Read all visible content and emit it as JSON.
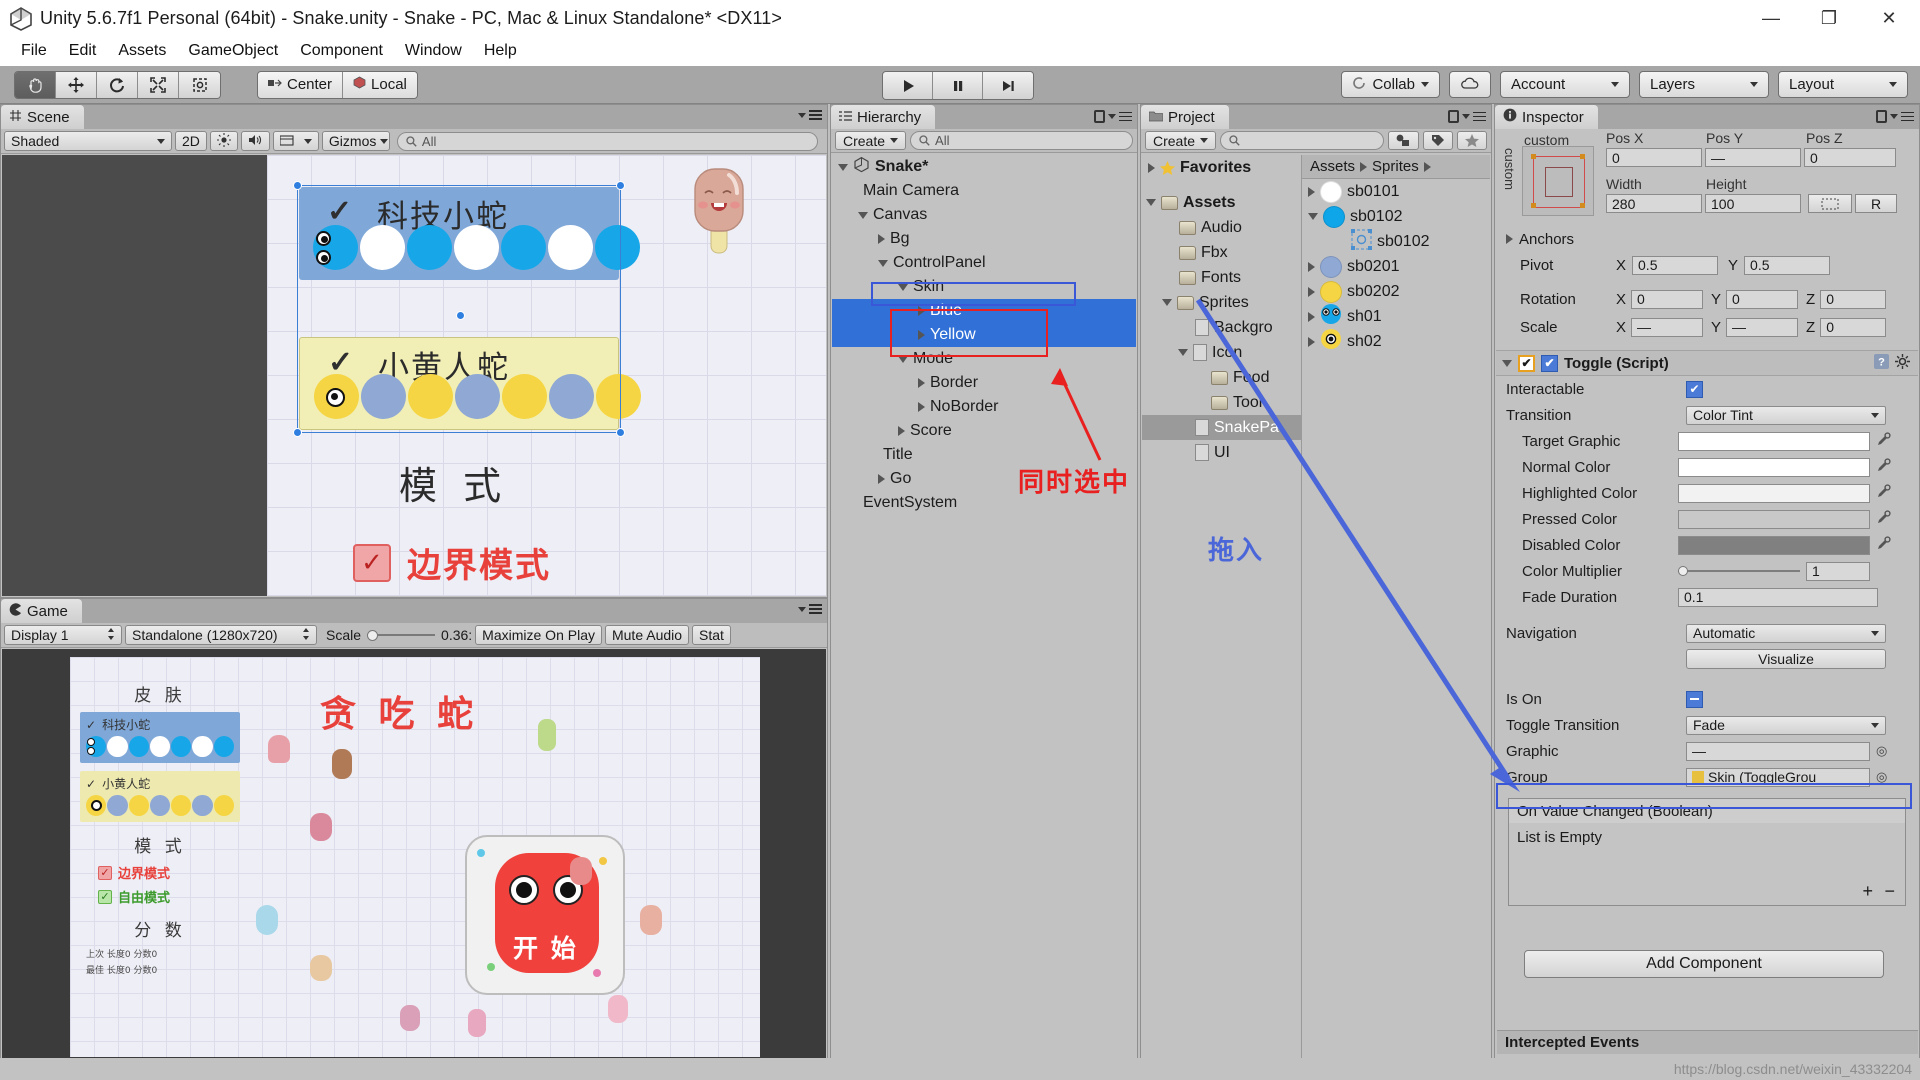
{
  "window": {
    "title": "Unity 5.6.7f1 Personal (64bit) - Snake.unity - Snake - PC, Mac & Linux Standalone* <DX11>",
    "minimize": "—",
    "maximize": "❐",
    "close": "✕"
  },
  "menubar": {
    "items": [
      "File",
      "Edit",
      "Assets",
      "GameObject",
      "Component",
      "Window",
      "Help"
    ]
  },
  "toolbar": {
    "tools": [
      "hand-tool",
      "move-tool",
      "rotate-tool",
      "scale-tool",
      "rect-tool"
    ],
    "pivot_mode": "Center",
    "handle_space": "Local",
    "play": "▶",
    "pause": "❚❚",
    "step": "▶❙",
    "collab": "Collab",
    "cloud": "cloud-icon",
    "account": "Account",
    "layers": "Layers",
    "layout": "Layout"
  },
  "scene": {
    "tab": "Scene",
    "shading": "Shaded",
    "mode_2d": "2D",
    "gizmos": "Gizmos",
    "search_placeholder": "All",
    "canvas": {
      "skin_blue": {
        "label": "科技小蛇",
        "check": "✓"
      },
      "skin_yellow": {
        "label": "小黄人蛇",
        "check": "✓"
      },
      "mode_title": "模 式",
      "mode_border": "边界模式"
    }
  },
  "game": {
    "tab": "Game",
    "display": "Display 1",
    "resolution": "Standalone (1280x720)",
    "scale_label": "Scale",
    "scale_value": "0.36:",
    "maximize": "Maximize On Play",
    "mute": "Mute Audio",
    "stats": "Stat",
    "screen": {
      "title": "贪 吃 蛇",
      "skin_heading": "皮 肤",
      "skin_blue": "科技小蛇",
      "skin_yellow": "小黄人蛇",
      "mode_heading": "模 式",
      "mode_border": "边界模式",
      "mode_free": "自由模式",
      "score_heading": "分 数",
      "score_line1": "上次  长度0  分数0",
      "score_line2": "最佳  长度0  分数0",
      "start_button": "开 始"
    }
  },
  "hierarchy": {
    "tab": "Hierarchy",
    "create": "Create",
    "search_placeholder": "All",
    "items": [
      {
        "label": "Snake*",
        "depth": 0,
        "arrow": "down",
        "icon": "unity-icon",
        "bold": true,
        "selected": false
      },
      {
        "label": "Main Camera",
        "depth": 1,
        "arrow": "none",
        "icon": "",
        "bold": false,
        "selected": false
      },
      {
        "label": "Canvas",
        "depth": 1,
        "arrow": "down",
        "icon": "",
        "bold": false,
        "selected": false
      },
      {
        "label": "Bg",
        "depth": 2,
        "arrow": "right",
        "icon": "",
        "bold": false,
        "selected": false
      },
      {
        "label": "ControlPanel",
        "depth": 2,
        "arrow": "down",
        "icon": "",
        "bold": false,
        "selected": false
      },
      {
        "label": "Skin",
        "depth": 3,
        "arrow": "down",
        "icon": "",
        "bold": false,
        "selected": false
      },
      {
        "label": "Blue",
        "depth": 4,
        "arrow": "right",
        "icon": "",
        "bold": false,
        "selected": true
      },
      {
        "label": "Yellow",
        "depth": 4,
        "arrow": "right",
        "icon": "",
        "bold": false,
        "selected": true
      },
      {
        "label": "Mode",
        "depth": 3,
        "arrow": "down",
        "icon": "",
        "bold": false,
        "selected": false
      },
      {
        "label": "Border",
        "depth": 4,
        "arrow": "right",
        "icon": "",
        "bold": false,
        "selected": false
      },
      {
        "label": "NoBorder",
        "depth": 4,
        "arrow": "right",
        "icon": "",
        "bold": false,
        "selected": false
      },
      {
        "label": "Score",
        "depth": 3,
        "arrow": "right",
        "icon": "",
        "bold": false,
        "selected": false
      },
      {
        "label": "Title",
        "depth": 2,
        "arrow": "none",
        "icon": "",
        "bold": false,
        "selected": false
      },
      {
        "label": "Go",
        "depth": 2,
        "arrow": "right",
        "icon": "",
        "bold": false,
        "selected": false
      },
      {
        "label": "EventSystem",
        "depth": 1,
        "arrow": "none",
        "icon": "",
        "bold": false,
        "selected": false
      }
    ]
  },
  "project": {
    "tab": "Project",
    "create": "Create",
    "search_placeholder": "",
    "favorites": "Favorites",
    "breadcrumb": [
      "Assets",
      "Sprites"
    ],
    "tree": [
      {
        "label": "Assets",
        "depth": 0,
        "arrow": "down",
        "icon": "folder",
        "selected": false
      },
      {
        "label": "Audio",
        "depth": 1,
        "arrow": "none",
        "icon": "folder",
        "selected": false
      },
      {
        "label": "Fbx",
        "depth": 1,
        "arrow": "none",
        "icon": "folder",
        "selected": false
      },
      {
        "label": "Fonts",
        "depth": 1,
        "arrow": "none",
        "icon": "folder",
        "selected": false
      },
      {
        "label": "Sprites",
        "depth": 1,
        "arrow": "down",
        "icon": "folder",
        "selected": false
      },
      {
        "label": "Backgro",
        "depth": 2,
        "arrow": "none",
        "icon": "sprite",
        "selected": false
      },
      {
        "label": "Icon",
        "depth": 2,
        "arrow": "down",
        "icon": "sprite",
        "selected": false
      },
      {
        "label": "Food",
        "depth": 3,
        "arrow": "none",
        "icon": "folder",
        "selected": false
      },
      {
        "label": "Tool",
        "depth": 3,
        "arrow": "none",
        "icon": "folder",
        "selected": false
      },
      {
        "label": "SnakePa",
        "depth": 2,
        "arrow": "none",
        "icon": "sprite",
        "selected": true
      },
      {
        "label": "UI",
        "depth": 2,
        "arrow": "none",
        "icon": "sprite",
        "selected": false
      }
    ],
    "assets": [
      {
        "label": "sb0101",
        "arrow": "right",
        "color": "#ffffff",
        "indent": 0,
        "type": "circle"
      },
      {
        "label": "sb0102",
        "arrow": "down",
        "color": "#0ea5e9",
        "indent": 0,
        "type": "circle"
      },
      {
        "label": "sb0102",
        "arrow": "none",
        "color": "",
        "indent": 1,
        "type": "sprite-thumb"
      },
      {
        "label": "sb0201",
        "arrow": "right",
        "color": "#8fa8d4",
        "indent": 0,
        "type": "circle"
      },
      {
        "label": "sb0202",
        "arrow": "right",
        "color": "#f5d543",
        "indent": 0,
        "type": "circle"
      },
      {
        "label": "sh01",
        "arrow": "right",
        "color": "#0ea5e9",
        "indent": 0,
        "type": "head-blue"
      },
      {
        "label": "sh02",
        "arrow": "right",
        "color": "#f5d543",
        "indent": 0,
        "type": "head-yellow"
      }
    ]
  },
  "inspector": {
    "tab": "Inspector",
    "rect": {
      "custom_label": "custom",
      "pos_x_label": "Pos X",
      "pos_x": "0",
      "pos_y_label": "Pos Y",
      "pos_y": "—",
      "pos_z_label": "Pos Z",
      "pos_z": "0",
      "width_label": "Width",
      "width": "280",
      "height_label": "Height",
      "height": "100",
      "blueprint_btn": "blueprint-icon",
      "raw_btn": "R",
      "anchors": "Anchors",
      "pivot": "Pivot",
      "pivot_x_label": "X",
      "pivot_x": "0.5",
      "pivot_y_label": "Y",
      "pivot_y": "0.5",
      "rotation": "Rotation",
      "rot_x_label": "X",
      "rot_x": "0",
      "rot_y_label": "Y",
      "rot_y": "0",
      "rot_z_label": "Z",
      "rot_z": "0",
      "scale": "Scale",
      "scale_x_label": "X",
      "scale_x": "—",
      "scale_y_label": "Y",
      "scale_y": "—",
      "scale_z_label": "Z",
      "scale_z": "0"
    },
    "toggle": {
      "title": "Toggle (Script)",
      "interactable_label": "Interactable",
      "interactable": true,
      "transition_label": "Transition",
      "transition": "Color Tint",
      "target_graphic_label": "Target Graphic",
      "target_graphic": "",
      "normal_color_label": "Normal Color",
      "normal_color": "#ffffff",
      "highlighted_color_label": "Highlighted Color",
      "highlighted_color": "#f2f2f2",
      "pressed_color_label": "Pressed Color",
      "pressed_color": "#c8c8c8",
      "disabled_color_label": "Disabled Color",
      "disabled_color": "#808080",
      "color_multiplier_label": "Color Multiplier",
      "color_multiplier": "1",
      "fade_duration_label": "Fade Duration",
      "fade_duration": "0.1",
      "navigation_label": "Navigation",
      "navigation": "Automatic",
      "visualize": "Visualize",
      "is_on_label": "Is On",
      "is_on": "mixed",
      "toggle_transition_label": "Toggle Transition",
      "toggle_transition": "Fade",
      "graphic_label": "Graphic",
      "graphic": "—",
      "group_label": "Group",
      "group": "Skin (ToggleGrou"
    },
    "events": {
      "header": "On Value Changed (Boolean)",
      "empty": "List is Empty",
      "add": "+",
      "remove": "−"
    },
    "add_component": "Add Component",
    "intercepted_events": "Intercepted Events"
  },
  "annotations": {
    "select_note": "同时选中",
    "drag_note": "拖入",
    "colors": {
      "red": "#e8201f",
      "blue": "#3a57d8",
      "select_blue": "#3170d6"
    }
  },
  "watermark": "https://blog.csdn.net/weixin_43332204"
}
